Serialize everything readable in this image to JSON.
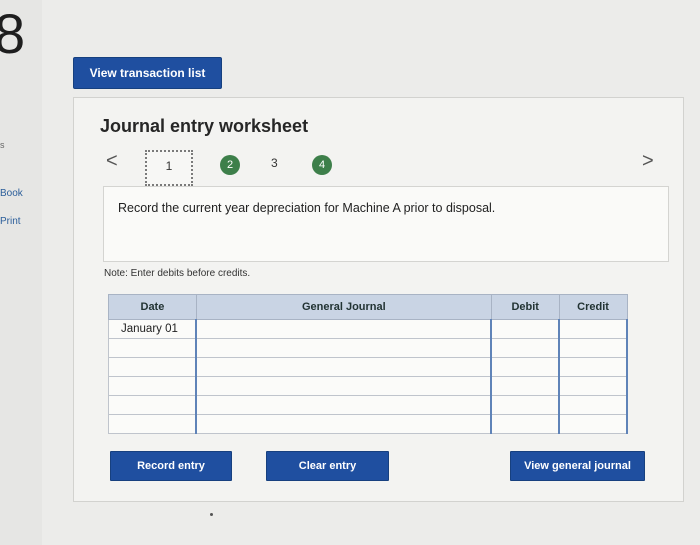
{
  "side": {
    "step_number": "8",
    "small_mark": "s",
    "book": "Book",
    "print": "Print"
  },
  "header": {
    "view_transactions": "View transaction list"
  },
  "worksheet": {
    "title": "Journal entry worksheet",
    "nav_prev": "<",
    "nav_next": ">",
    "steps": [
      "1",
      "2",
      "3",
      "4"
    ],
    "current_step": "1",
    "completed_steps": [
      "2",
      "4"
    ],
    "instruction": "Record the current year depreciation for Machine A prior to disposal.",
    "note": "Note: Enter debits before credits."
  },
  "table": {
    "headers": [
      "Date",
      "General Journal",
      "Debit",
      "Credit"
    ],
    "rows": [
      [
        "January 01",
        "",
        "",
        ""
      ],
      [
        "",
        "",
        "",
        ""
      ],
      [
        "",
        "",
        "",
        ""
      ],
      [
        "",
        "",
        "",
        ""
      ],
      [
        "",
        "",
        "",
        ""
      ],
      [
        "",
        "",
        "",
        ""
      ]
    ]
  },
  "buttons": {
    "record": "Record entry",
    "clear": "Clear entry",
    "view_general": "View general journal"
  },
  "colors": {
    "primary_button": "#1f4fa0",
    "completed_step": "#3d7f4a",
    "table_header": "#c9d4e4"
  }
}
